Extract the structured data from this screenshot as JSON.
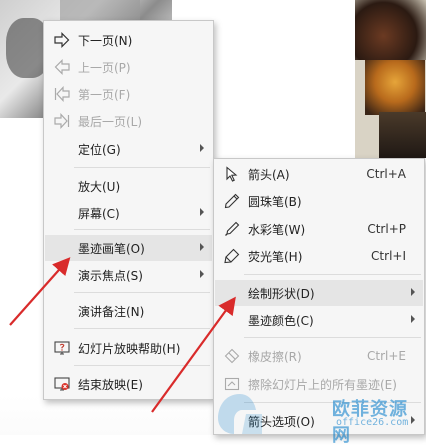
{
  "main_menu": {
    "items": [
      {
        "label": "下一页(N)",
        "icon": "arrow-right-outline-icon",
        "disabled": false
      },
      {
        "label": "上一页(P)",
        "icon": "arrow-left-outline-icon",
        "disabled": true
      },
      {
        "label": "第一页(F)",
        "icon": "arrow-first-outline-icon",
        "disabled": true
      },
      {
        "label": "最后一页(L)",
        "icon": "arrow-last-outline-icon",
        "disabled": true
      },
      {
        "label": "定位(G)",
        "submenu": true
      },
      {
        "label": "放大(U)"
      },
      {
        "label": "屏幕(C)",
        "submenu": true
      },
      {
        "label": "墨迹画笔(O)",
        "submenu": true,
        "highlighted": true
      },
      {
        "label": "演示焦点(S)",
        "submenu": true
      },
      {
        "label": "演讲备注(N)"
      },
      {
        "label": "幻灯片放映帮助(H)",
        "icon": "help-icon"
      },
      {
        "label": "结束放映(E)",
        "icon": "end-show-icon"
      }
    ]
  },
  "sub_menu": {
    "items": [
      {
        "label": "箭头(A)",
        "shortcut": "Ctrl+A",
        "icon": "cursor-arrow-icon"
      },
      {
        "label": "圆珠笔(B)",
        "icon": "ballpoint-pen-icon"
      },
      {
        "label": "水彩笔(W)",
        "shortcut": "Ctrl+P",
        "icon": "watercolor-pen-icon"
      },
      {
        "label": "荧光笔(H)",
        "shortcut": "Ctrl+I",
        "icon": "highlighter-icon"
      },
      {
        "label": "绘制形状(D)",
        "submenu": true,
        "highlighted": true
      },
      {
        "label": "墨迹颜色(C)",
        "submenu": true
      },
      {
        "label": "橡皮擦(R)",
        "shortcut": "Ctrl+E",
        "disabled": true,
        "icon": "eraser-icon"
      },
      {
        "label": "擦除幻灯片上的所有墨迹(E)",
        "disabled": true,
        "icon": "erase-all-icon"
      },
      {
        "label": "箭头选项(O)",
        "submenu": true
      }
    ]
  },
  "watermark": {
    "cn": "欧菲资源网",
    "url": "office26.com"
  },
  "colors": {
    "annotation_arrow": "#d92b2b",
    "menu_bg": "#f6f6f6",
    "highlight": "#e5e5e5"
  }
}
